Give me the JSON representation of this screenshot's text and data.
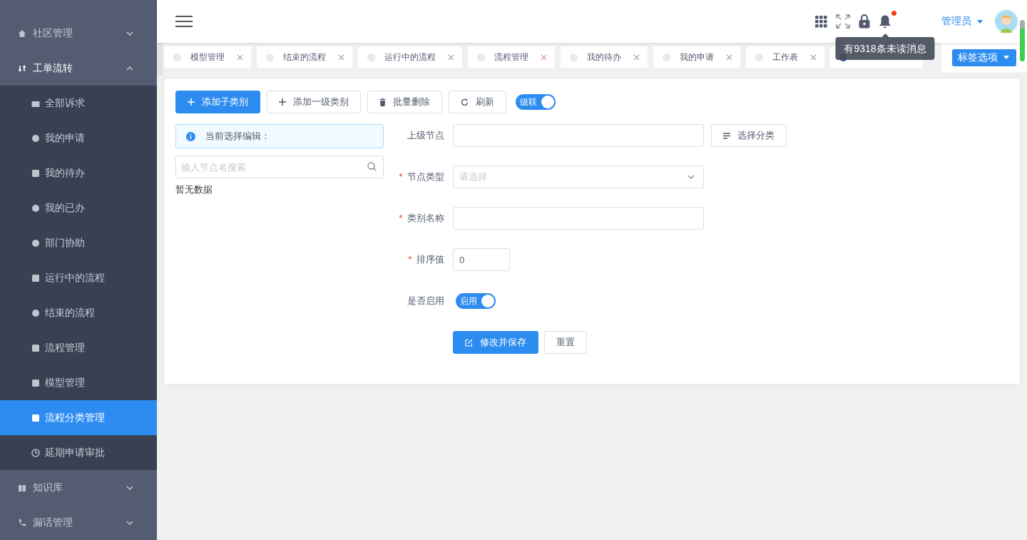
{
  "sidebar": {
    "items": [
      {
        "label": "社区管理",
        "expanded": false
      },
      {
        "label": "工单流转",
        "expanded": true,
        "children": [
          {
            "label": "全部诉求",
            "selected": false
          },
          {
            "label": "我的申请",
            "selected": false
          },
          {
            "label": "我的待办",
            "selected": false
          },
          {
            "label": "我的已办",
            "selected": false
          },
          {
            "label": "部门协助",
            "selected": false
          },
          {
            "label": "运行中的流程",
            "selected": false
          },
          {
            "label": "结束的流程",
            "selected": false
          },
          {
            "label": "流程管理",
            "selected": false
          },
          {
            "label": "模型管理",
            "selected": false
          },
          {
            "label": "流程分类管理",
            "selected": true
          },
          {
            "label": "延期申请审批",
            "selected": false
          }
        ]
      },
      {
        "label": "知识库",
        "expanded": false
      },
      {
        "label": "漏话管理",
        "expanded": false
      }
    ]
  },
  "header": {
    "notification_unread": true,
    "user": "管理员",
    "tooltip": "有9318条未读消息"
  },
  "tabs": [
    {
      "label": "模型管理",
      "selected": false
    },
    {
      "label": "结束的流程",
      "selected": false
    },
    {
      "label": "运行中的流程",
      "selected": false
    },
    {
      "label": "流程管理",
      "selected": false
    },
    {
      "label": "我的待办",
      "selected": false
    },
    {
      "label": "我的申请",
      "selected": false
    },
    {
      "label": "工作表",
      "selected": false
    },
    {
      "selected": true
    }
  ],
  "tab_options": "标签选项",
  "toolbar": {
    "buttons": [
      {
        "label": "添加子类别",
        "kind": "primary"
      },
      {
        "label": "添加一级类别",
        "kind": "add"
      },
      {
        "label": "批量删除",
        "kind": "delete"
      },
      {
        "label": "刷新",
        "kind": "refresh"
      }
    ],
    "cascade": {
      "label": "级联",
      "on": true
    }
  },
  "tree": {
    "info": "当前选择编辑：",
    "search_placeholder": "输入节点名搜索",
    "empty": "暂无数据"
  },
  "form": {
    "fields": [
      {
        "kind": "input",
        "label": "上级节点",
        "button": "选择分类"
      },
      {
        "kind": "select",
        "label": "节点类型",
        "required_mark": "*",
        "placeholder": "请选择"
      },
      {
        "kind": "input",
        "label": "类别名称",
        "required_mark": "*"
      },
      {
        "kind": "number",
        "label": "排序值",
        "required_mark": "*",
        "value": "0"
      },
      {
        "kind": "switch",
        "label": "是否启用",
        "on": true,
        "text": "启用"
      }
    ],
    "save": "修改并保存",
    "reset": "重置"
  }
}
